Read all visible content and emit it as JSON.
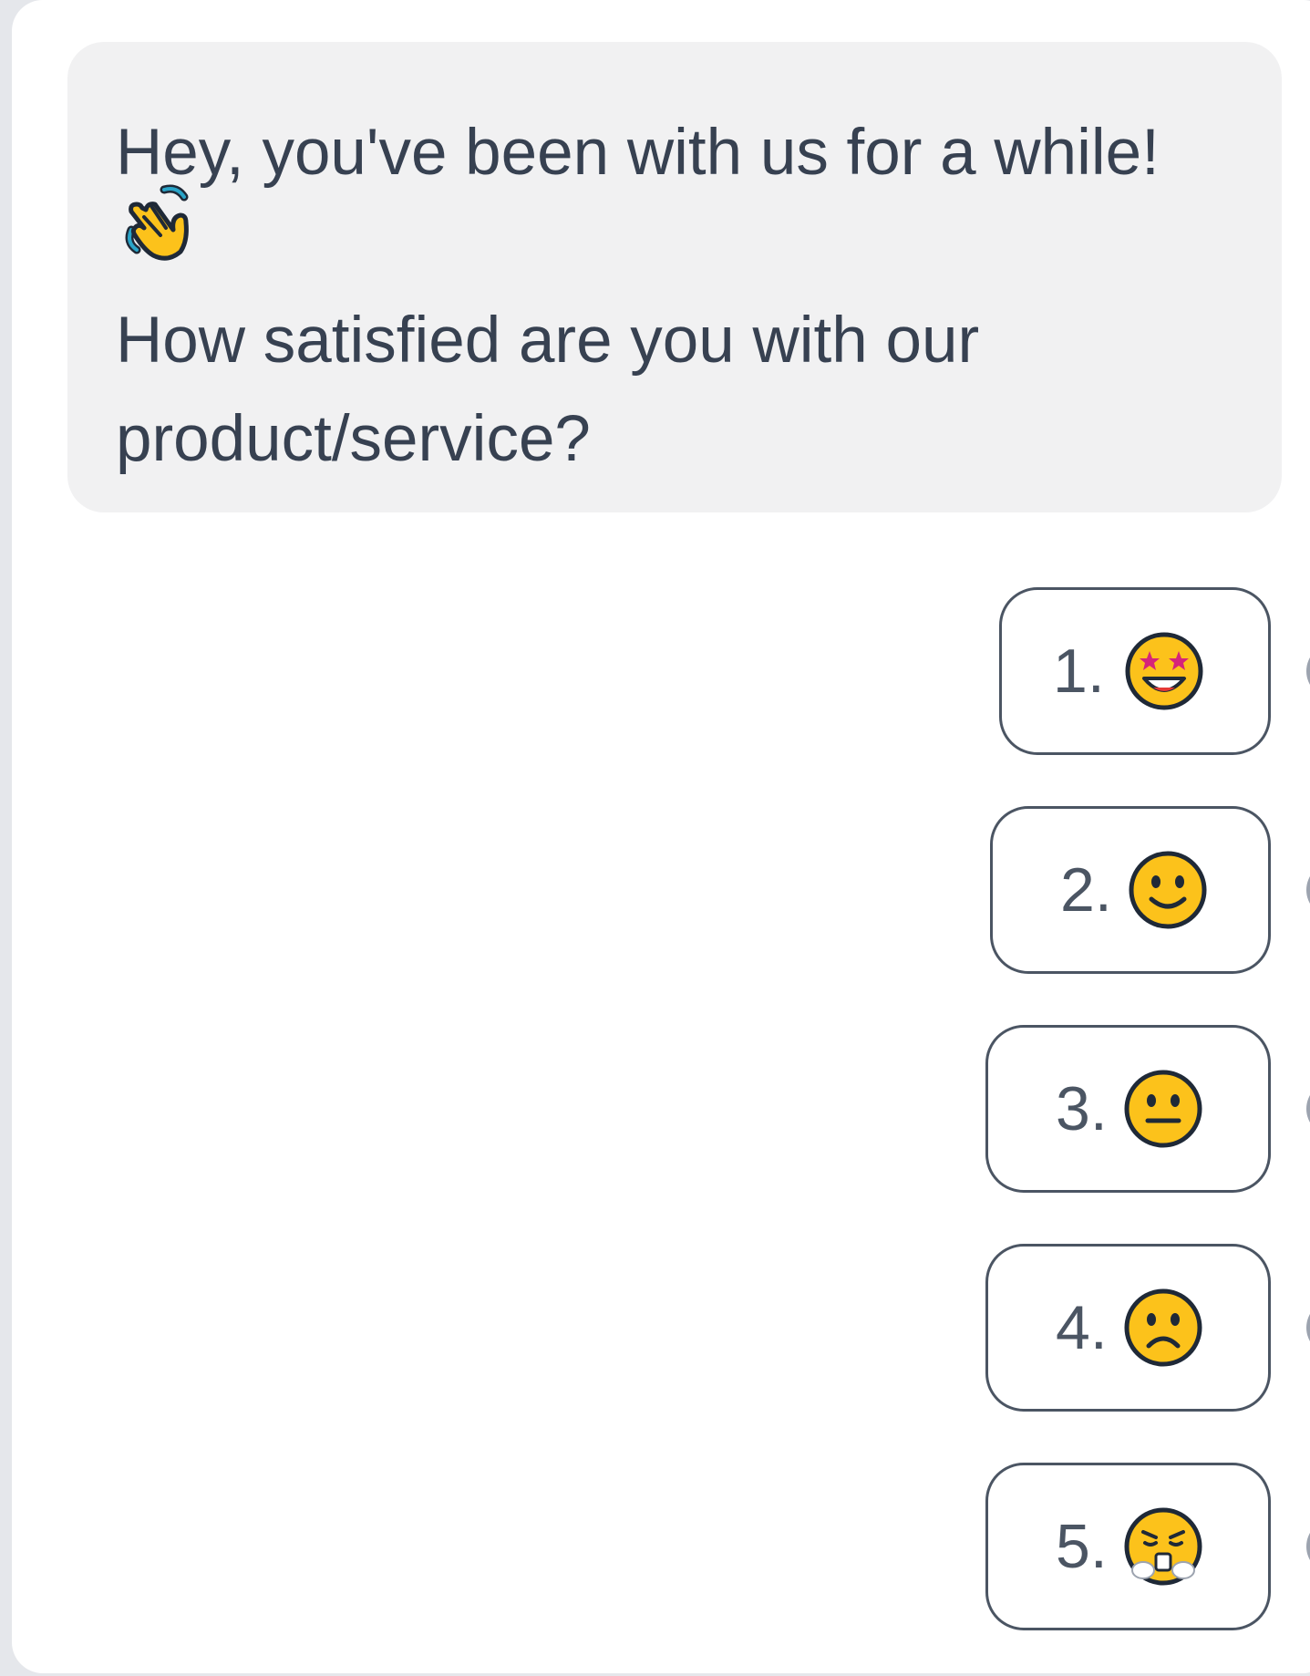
{
  "message": {
    "greeting": "Hey, you've been with us for a while!",
    "greeting_emoji": "waving-hand-icon",
    "question": "How satisfied are you with our product/service?"
  },
  "options": [
    {
      "label": "1.",
      "icon": "star-struck-face-icon"
    },
    {
      "label": "2.",
      "icon": "slightly-smiling-face-icon"
    },
    {
      "label": "3.",
      "icon": "neutral-face-icon"
    },
    {
      "label": "4.",
      "icon": "slightly-frowning-face-icon"
    },
    {
      "label": "5.",
      "icon": "face-with-steam-from-nose-icon"
    }
  ],
  "colors": {
    "bubble_bg": "#f1f1f2",
    "text": "#374151",
    "border": "#4b5563",
    "emoji_yellow": "#fcc21b"
  }
}
